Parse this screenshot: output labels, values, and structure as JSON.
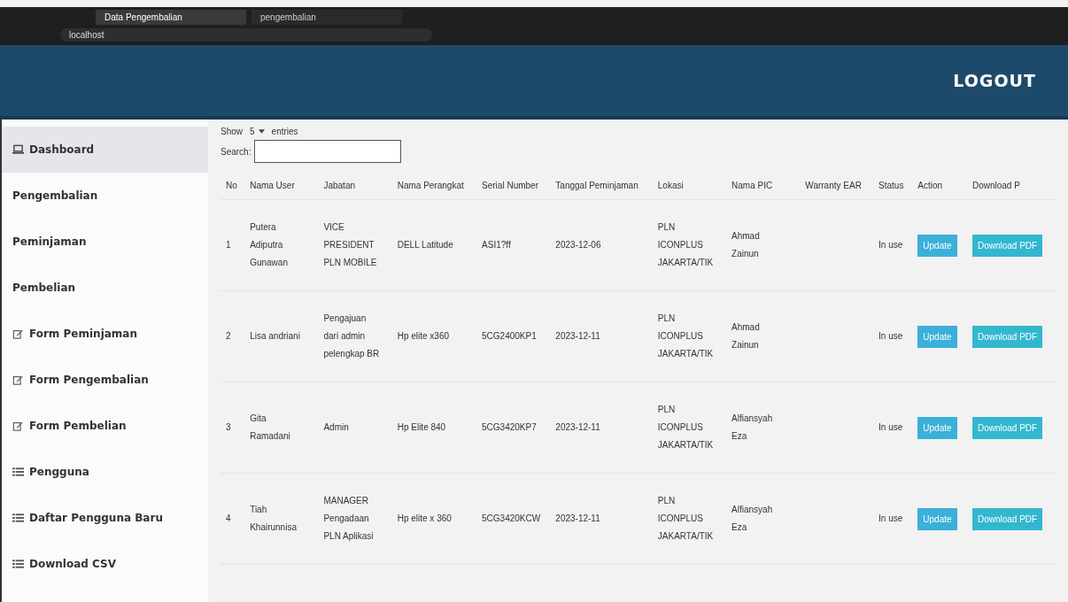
{
  "browser": {
    "tabs": [
      {
        "title": "Data Pengembalian",
        "selected": true
      },
      {
        "title": "pengembalian",
        "selected": false
      }
    ],
    "address": "localhost"
  },
  "header": {
    "logout": "LOGOUT"
  },
  "sidebar": {
    "items": [
      {
        "label": "Dashboard",
        "kind": "monitor",
        "selected": true
      },
      {
        "label": "Pengembalian",
        "kind": "plain",
        "selected": false
      },
      {
        "label": "Peminjaman",
        "kind": "plain",
        "selected": false
      },
      {
        "label": "Pembelian",
        "kind": "plain",
        "selected": false
      },
      {
        "label": "Form Peminjaman",
        "kind": "form",
        "selected": false
      },
      {
        "label": "Form Pengembalian",
        "kind": "form",
        "selected": false
      },
      {
        "label": "Form Pembelian",
        "kind": "form",
        "selected": false
      },
      {
        "label": "Pengguna",
        "kind": "list",
        "selected": false
      },
      {
        "label": "Daftar Pengguna Baru",
        "kind": "list",
        "selected": false
      },
      {
        "label": "Download CSV",
        "kind": "list",
        "selected": false
      }
    ]
  },
  "controls": {
    "show_label": "Show",
    "show_value": "5",
    "entries_label": "entries",
    "search_label": "Search:"
  },
  "table": {
    "columns": [
      "No",
      "Nama User",
      "Jabatan",
      "Nama Perangkat",
      "Serial Number",
      "Tanggal Peminjaman",
      "Lokasi",
      "Nama PIC",
      "Warranty EAR",
      "Status",
      "Action",
      "Download P"
    ],
    "rows": [
      {
        "cells": [
          "1",
          "Putera Adiputra Gunawan",
          "VICE PRESIDENT PLN MOBILE",
          "DELL Latitude",
          "ASI1?ff",
          "2023-12-06",
          "PLN ICONPLUS JAKARTA/TIK",
          "Ahmad Zainun",
          "",
          "In use"
        ],
        "action": "Update",
        "download": "Download PDF"
      },
      {
        "cells": [
          "2",
          "Lisa andriani",
          "Pengajuan dari admin pelengkap BR",
          "Hp elite x360",
          "5CG2400KP1",
          "2023-12-11",
          "PLN ICONPLUS JAKARTA/TIK",
          "Ahmad Zainun",
          "",
          "In use"
        ],
        "action": "Update",
        "download": "Download PDF"
      },
      {
        "cells": [
          "3",
          "Gita Ramadani",
          "Admin",
          "Hp Elite 840",
          "5CG3420KP7",
          "2023-12-11",
          "PLN ICONPLUS JAKARTA/TIK",
          "Alfiansyah Eza",
          "",
          "In use"
        ],
        "action": "Update",
        "download": "Download PDF"
      },
      {
        "cells": [
          "4",
          "Tiah Khairunnisa",
          "MANAGER Pengadaan PLN Aplikasi",
          "Hp elite x 360",
          "5CG3420KCW",
          "2023-12-11",
          "PLN ICONPLUS JAKARTA/TIK",
          "Alfiansyah Eza",
          "",
          "In use"
        ],
        "action": "Update",
        "download": "Download PDF"
      }
    ]
  }
}
